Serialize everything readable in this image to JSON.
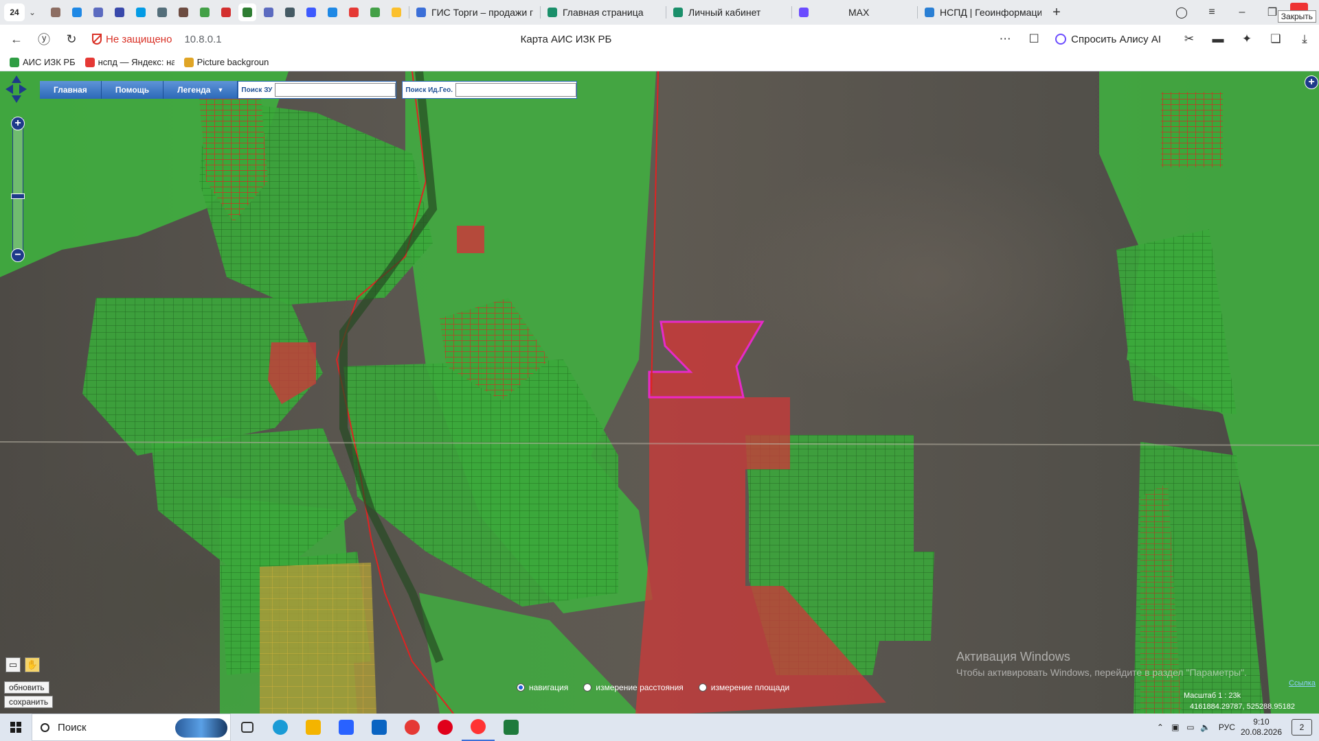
{
  "browser": {
    "tab_count": "24",
    "tabs": [
      {
        "label": "ГИС Торги – продажи г",
        "color": "#3b6fd8"
      },
      {
        "label": "Главная страница",
        "color": "#1a8f6a"
      },
      {
        "label": "Личный кабинет",
        "color": "#1a8f6a"
      },
      {
        "label": "MAX",
        "color": "#6b4cff"
      },
      {
        "label": "НСПД | Геоинформаци",
        "color": "#2a7fd4"
      }
    ],
    "close_tooltip": "Закрыть",
    "insecure_label": "Не защищено",
    "url": "10.8.0.1",
    "page_title": "Карта АИС ИЗК РБ",
    "alice_label": "Спросить Алису AI",
    "bookmarks": [
      {
        "label": "АИС ИЗК РБ",
        "color": "#2f9e44"
      },
      {
        "label": "нспд — Яндекс: на",
        "color": "#e53935"
      },
      {
        "label": "Picture backgroun",
        "color": "#e0a526"
      }
    ],
    "pinned_colors": [
      "#8d6e63",
      "#1e88e5",
      "#5c6bc0",
      "#3949ab",
      "#039be5",
      "#546e7a",
      "#6d4c41",
      "#43a047",
      "#d32f2f",
      "#2e7d32",
      "#5c6bc0",
      "#455a64",
      "#3d5afe",
      "#1e88e5",
      "#e53935",
      "#43a047",
      "#fbc02d"
    ]
  },
  "map": {
    "menu": [
      {
        "label": "Главная"
      },
      {
        "label": "Помощь"
      },
      {
        "label": "Легенда"
      }
    ],
    "search_zu_label": "Поиск ЗУ",
    "search_zu_value": "",
    "search_geo_label": "Поиск Ид.Гео.",
    "search_geo_value": "",
    "refresh_label": "обновить",
    "save_label": "сохранить",
    "modes": [
      {
        "label": "навигация",
        "selected": true
      },
      {
        "label": "измерение расстояния",
        "selected": false
      },
      {
        "label": "измерение площади",
        "selected": false
      }
    ],
    "watermark_line1": "Активация Windows",
    "watermark_line2": "Чтобы активировать Windows, перейдите в раздел \"Параметры\".",
    "scale_label": "Масштаб 1 : 23k",
    "coords": "4161884.29787, 525288.95182",
    "link_label": "Ссылка",
    "colors": {
      "parcel_green": "#3fbf3f",
      "parcel_red": "#d23a3a",
      "selected_outline": "#ff22dd",
      "orange_zone": "#c9a33a"
    }
  },
  "taskbar": {
    "search_placeholder": "Поиск",
    "apps": [
      {
        "name": "task-view",
        "color": "#333333"
      },
      {
        "name": "edge",
        "color": "#1a9bd6"
      },
      {
        "name": "explorer",
        "color": "#f4b400"
      },
      {
        "name": "store",
        "color": "#2962ff"
      },
      {
        "name": "outlook",
        "color": "#0a64c2"
      },
      {
        "name": "yandex",
        "color": "#e53935"
      },
      {
        "name": "opera",
        "color": "#e0001b"
      },
      {
        "name": "yandex-browser",
        "color": "#ff3333"
      },
      {
        "name": "excel",
        "color": "#1e7a3c"
      }
    ],
    "language": "РУС",
    "time": "9:10",
    "date": "20.08.2026",
    "notifications": "2"
  }
}
